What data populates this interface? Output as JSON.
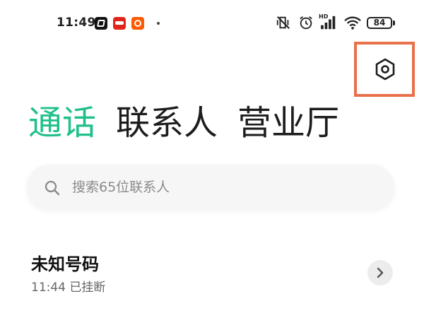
{
  "status_bar": {
    "time": "11:49",
    "notification_icons": [
      "capcut-icon",
      "jd-icon",
      "taobao-icon"
    ],
    "battery": "84",
    "hd_label": "HD",
    "system_icons": [
      "mute-vibrate-icon",
      "alarm-icon",
      "signal-icon",
      "wifi-icon",
      "battery-icon"
    ]
  },
  "toolbar": {
    "settings_icon": "settings-hexagon-icon"
  },
  "tabs": [
    {
      "label": "通话",
      "active": true
    },
    {
      "label": "联系人",
      "active": false
    },
    {
      "label": "营业厅",
      "active": false
    }
  ],
  "search": {
    "placeholder": "搜索65位联系人",
    "icon": "search-icon"
  },
  "calls": [
    {
      "name": "未知号码",
      "time": "11:44",
      "status": "已挂断"
    }
  ],
  "colors": {
    "accent": "#21c08b",
    "highlight_border": "#e8704a",
    "text_primary": "#1a1a1a",
    "text_secondary": "#666666"
  }
}
